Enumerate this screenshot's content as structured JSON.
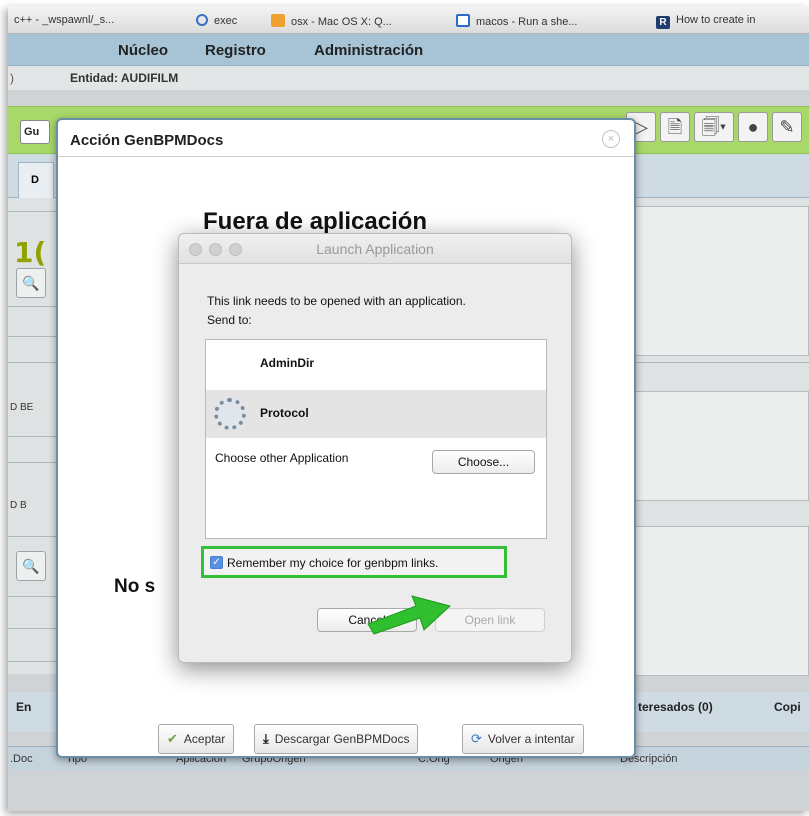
{
  "bookmarks": [
    {
      "label": "c++ - _wspawnl/_s...",
      "icon": "so-icon"
    },
    {
      "label": "exec",
      "icon": "brace-icon"
    },
    {
      "label": "osx - Mac OS X: Q...",
      "icon": "stack-icon"
    },
    {
      "label": "macos - Run a she...",
      "icon": "su-icon"
    },
    {
      "label": "How to create in",
      "icon": "r-icon"
    }
  ],
  "menu": {
    "items": [
      "Núcleo",
      "Registro",
      "Administración"
    ]
  },
  "entity": {
    "paren": ")",
    "label": "Entidad: AUDIFILM"
  },
  "toolbar": {
    "gu_label": "Gu"
  },
  "bg": {
    "tab_label": "D",
    "big_value": "1(",
    "label_dbe1": "D BE",
    "label_dbe2": "D B",
    "magnifier": "🔍"
  },
  "bottom_tabs": {
    "left": "En",
    "interesados": "teresados (0)",
    "copias": "Copi"
  },
  "table_headers": [
    ".Doc",
    "Tipo",
    "Aplicación",
    "GrupoOrigen",
    "C.Orig",
    "Origen",
    "Descripción"
  ],
  "dialog": {
    "title": "Acción GenBPMDocs",
    "close": "×",
    "heading_partial": "Fuera de aplicación",
    "no_text": "No s",
    "buttons": {
      "accept": "Aceptar",
      "download": "Descargar GenBPMDocs",
      "retry": "Volver a intentar"
    }
  },
  "launch": {
    "title": "Launch Application",
    "message_line1": "This link needs to be opened with an application.",
    "message_line2": "Send to:",
    "apps": [
      "AdminDir",
      "Protocol"
    ],
    "choose_other": "Choose other Application",
    "choose_btn": "Choose...",
    "remember": "Remember my choice for genbpm links.",
    "remember_checked": true,
    "cancel": "Cancel",
    "open_link": "Open link"
  },
  "colors": {
    "menu_bg": "#a6c4d6",
    "toolbar_green": "#a8d86a",
    "highlight_green": "#33c038",
    "arrow_green": "#2fbf2f"
  }
}
